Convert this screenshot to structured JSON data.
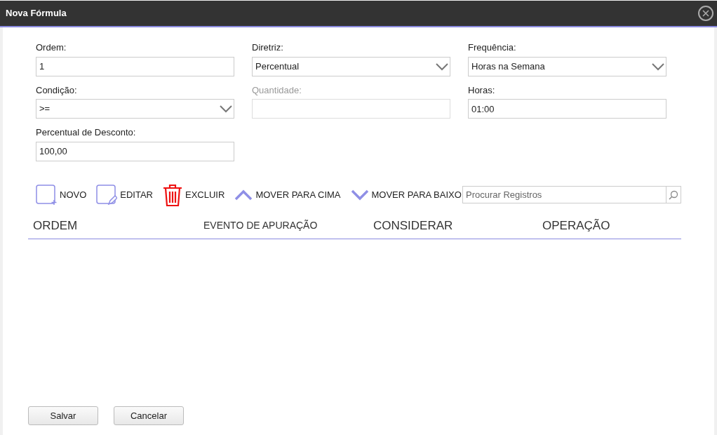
{
  "window": {
    "title": "Nova Fórmula"
  },
  "fields": [
    {
      "label": "Ordem:",
      "kind": "text",
      "value": "1",
      "disabled": false
    },
    {
      "label": "Diretriz:",
      "kind": "select",
      "value": "Percentual",
      "disabled": false
    },
    {
      "label": "Frequência:",
      "kind": "select",
      "value": "Horas na Semana",
      "disabled": false
    },
    {
      "label": "Condição:",
      "kind": "select",
      "value": ">=",
      "disabled": false
    },
    {
      "label": "Quantidade:",
      "kind": "text",
      "disabled": true
    },
    {
      "label": "Horas:",
      "kind": "text",
      "value": "01:00",
      "disabled": false
    },
    {
      "label": "Percentual de Desconto:",
      "kind": "text",
      "value": "100,00",
      "disabled": false
    }
  ],
  "toolbar": [
    {
      "label": "NOVO",
      "kind": "new"
    },
    {
      "label": "EDITAR",
      "kind": "edit"
    },
    {
      "label": "EXCLUIR",
      "kind": "delete"
    },
    {
      "label": "MOVER PARA CIMA",
      "kind": "up"
    },
    {
      "label": "MOVER PARA BAIXO",
      "kind": "down"
    }
  ],
  "search": {
    "placeholder": "Procurar Registros"
  },
  "table": {
    "columns": [
      {
        "label": "ORDEM",
        "kind": "large"
      },
      {
        "label": "EVENTO DE APURAÇÃO",
        "kind": "small"
      },
      {
        "label": "CONSIDERAR",
        "kind": "large"
      },
      {
        "label": "OPERAÇÃO",
        "kind": "large"
      }
    ]
  },
  "buttons": [
    "Salvar",
    "Cancelar"
  ]
}
